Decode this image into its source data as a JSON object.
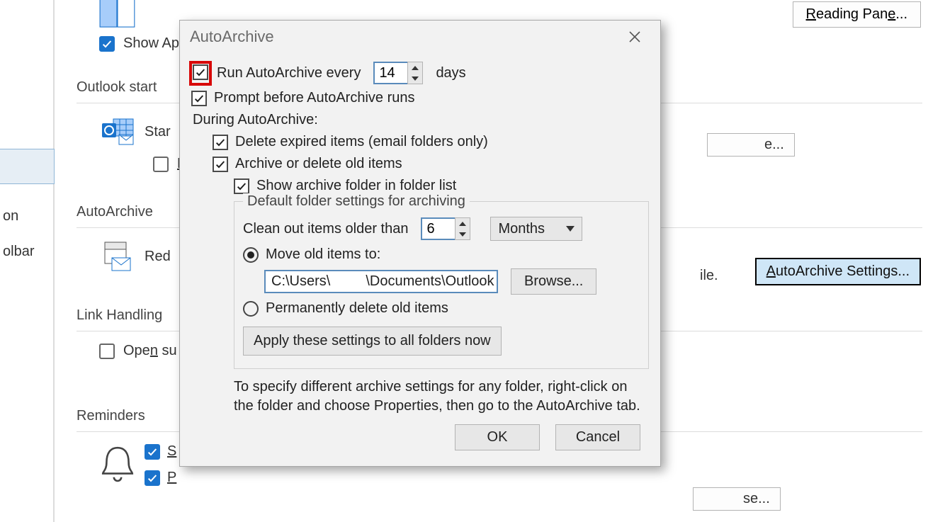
{
  "background": {
    "reading_pane_btn": "Reading Pane...",
    "autoarchive_settings_btn": "AutoArchive Settings...",
    "show_ap_label": "Show Ap",
    "outlookstart_heading": "Outlook start",
    "start_label": "Star",
    "autoarchive_heading": "AutoArchive",
    "red_label": "Red",
    "link_heading": "Link Handling",
    "open_su_label": "Open su",
    "reminders_heading": "Reminders",
    "sidebar_item1": "on",
    "sidebar_item2": "olbar",
    "peek_e": "e...",
    "peek_file": "ile.",
    "peek_se": "se..."
  },
  "dialog": {
    "title": "AutoArchive",
    "run_every_label_pre": "Run AutoArchive every",
    "run_every_value": "14",
    "run_every_label_post": "days",
    "prompt_label": "Prompt before AutoArchive runs",
    "during_label": "During AutoArchive:",
    "delete_expired_label": "Delete expired items (email folders only)",
    "archive_delete_label": "Archive or delete old items",
    "show_archive_folder_label": "Show archive folder in folder list",
    "group_legend": "Default folder settings for archiving",
    "clean_out_label": "Clean out items older than",
    "clean_out_value": "6",
    "clean_out_unit": "Months",
    "move_to_label": "Move old items to:",
    "move_to_path": "C:\\Users\\         \\Documents\\Outlook",
    "browse_btn": "Browse...",
    "perm_delete_label": "Permanently delete old items",
    "apply_btn": "Apply these settings to all folders now",
    "hint": "To specify different archive settings for any folder, right-click on the folder and choose Properties, then go to the AutoArchive tab.",
    "ok_btn": "OK",
    "cancel_btn": "Cancel"
  }
}
